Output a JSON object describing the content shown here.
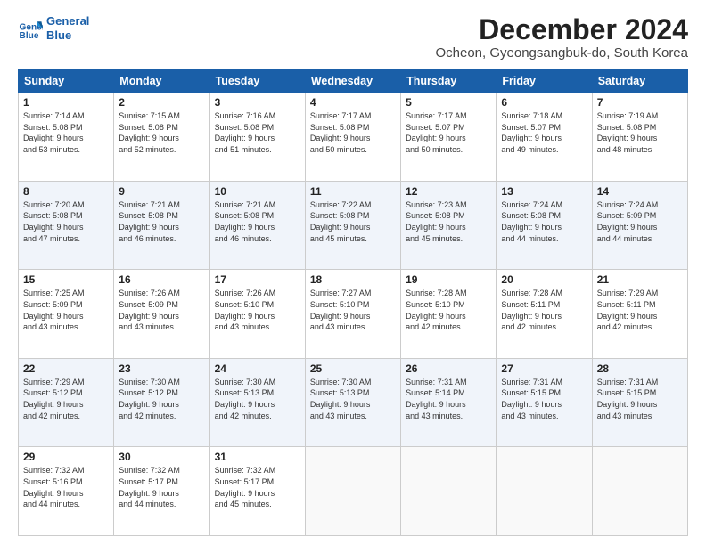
{
  "logo": {
    "line1": "General",
    "line2": "Blue"
  },
  "header": {
    "month": "December 2024",
    "location": "Ocheon, Gyeongsangbuk-do, South Korea"
  },
  "weekdays": [
    "Sunday",
    "Monday",
    "Tuesday",
    "Wednesday",
    "Thursday",
    "Friday",
    "Saturday"
  ],
  "weeks": [
    [
      {
        "day": "1",
        "text": "Sunrise: 7:14 AM\nSunset: 5:08 PM\nDaylight: 9 hours\nand 53 minutes."
      },
      {
        "day": "2",
        "text": "Sunrise: 7:15 AM\nSunset: 5:08 PM\nDaylight: 9 hours\nand 52 minutes."
      },
      {
        "day": "3",
        "text": "Sunrise: 7:16 AM\nSunset: 5:08 PM\nDaylight: 9 hours\nand 51 minutes."
      },
      {
        "day": "4",
        "text": "Sunrise: 7:17 AM\nSunset: 5:08 PM\nDaylight: 9 hours\nand 50 minutes."
      },
      {
        "day": "5",
        "text": "Sunrise: 7:17 AM\nSunset: 5:07 PM\nDaylight: 9 hours\nand 50 minutes."
      },
      {
        "day": "6",
        "text": "Sunrise: 7:18 AM\nSunset: 5:07 PM\nDaylight: 9 hours\nand 49 minutes."
      },
      {
        "day": "7",
        "text": "Sunrise: 7:19 AM\nSunset: 5:08 PM\nDaylight: 9 hours\nand 48 minutes."
      }
    ],
    [
      {
        "day": "8",
        "text": "Sunrise: 7:20 AM\nSunset: 5:08 PM\nDaylight: 9 hours\nand 47 minutes."
      },
      {
        "day": "9",
        "text": "Sunrise: 7:21 AM\nSunset: 5:08 PM\nDaylight: 9 hours\nand 46 minutes."
      },
      {
        "day": "10",
        "text": "Sunrise: 7:21 AM\nSunset: 5:08 PM\nDaylight: 9 hours\nand 46 minutes."
      },
      {
        "day": "11",
        "text": "Sunrise: 7:22 AM\nSunset: 5:08 PM\nDaylight: 9 hours\nand 45 minutes."
      },
      {
        "day": "12",
        "text": "Sunrise: 7:23 AM\nSunset: 5:08 PM\nDaylight: 9 hours\nand 45 minutes."
      },
      {
        "day": "13",
        "text": "Sunrise: 7:24 AM\nSunset: 5:08 PM\nDaylight: 9 hours\nand 44 minutes."
      },
      {
        "day": "14",
        "text": "Sunrise: 7:24 AM\nSunset: 5:09 PM\nDaylight: 9 hours\nand 44 minutes."
      }
    ],
    [
      {
        "day": "15",
        "text": "Sunrise: 7:25 AM\nSunset: 5:09 PM\nDaylight: 9 hours\nand 43 minutes."
      },
      {
        "day": "16",
        "text": "Sunrise: 7:26 AM\nSunset: 5:09 PM\nDaylight: 9 hours\nand 43 minutes."
      },
      {
        "day": "17",
        "text": "Sunrise: 7:26 AM\nSunset: 5:10 PM\nDaylight: 9 hours\nand 43 minutes."
      },
      {
        "day": "18",
        "text": "Sunrise: 7:27 AM\nSunset: 5:10 PM\nDaylight: 9 hours\nand 43 minutes."
      },
      {
        "day": "19",
        "text": "Sunrise: 7:28 AM\nSunset: 5:10 PM\nDaylight: 9 hours\nand 42 minutes."
      },
      {
        "day": "20",
        "text": "Sunrise: 7:28 AM\nSunset: 5:11 PM\nDaylight: 9 hours\nand 42 minutes."
      },
      {
        "day": "21",
        "text": "Sunrise: 7:29 AM\nSunset: 5:11 PM\nDaylight: 9 hours\nand 42 minutes."
      }
    ],
    [
      {
        "day": "22",
        "text": "Sunrise: 7:29 AM\nSunset: 5:12 PM\nDaylight: 9 hours\nand 42 minutes."
      },
      {
        "day": "23",
        "text": "Sunrise: 7:30 AM\nSunset: 5:12 PM\nDaylight: 9 hours\nand 42 minutes."
      },
      {
        "day": "24",
        "text": "Sunrise: 7:30 AM\nSunset: 5:13 PM\nDaylight: 9 hours\nand 42 minutes."
      },
      {
        "day": "25",
        "text": "Sunrise: 7:30 AM\nSunset: 5:13 PM\nDaylight: 9 hours\nand 43 minutes."
      },
      {
        "day": "26",
        "text": "Sunrise: 7:31 AM\nSunset: 5:14 PM\nDaylight: 9 hours\nand 43 minutes."
      },
      {
        "day": "27",
        "text": "Sunrise: 7:31 AM\nSunset: 5:15 PM\nDaylight: 9 hours\nand 43 minutes."
      },
      {
        "day": "28",
        "text": "Sunrise: 7:31 AM\nSunset: 5:15 PM\nDaylight: 9 hours\nand 43 minutes."
      }
    ],
    [
      {
        "day": "29",
        "text": "Sunrise: 7:32 AM\nSunset: 5:16 PM\nDaylight: 9 hours\nand 44 minutes."
      },
      {
        "day": "30",
        "text": "Sunrise: 7:32 AM\nSunset: 5:17 PM\nDaylight: 9 hours\nand 44 minutes."
      },
      {
        "day": "31",
        "text": "Sunrise: 7:32 AM\nSunset: 5:17 PM\nDaylight: 9 hours\nand 45 minutes."
      },
      {
        "day": "",
        "text": ""
      },
      {
        "day": "",
        "text": ""
      },
      {
        "day": "",
        "text": ""
      },
      {
        "day": "",
        "text": ""
      }
    ]
  ]
}
